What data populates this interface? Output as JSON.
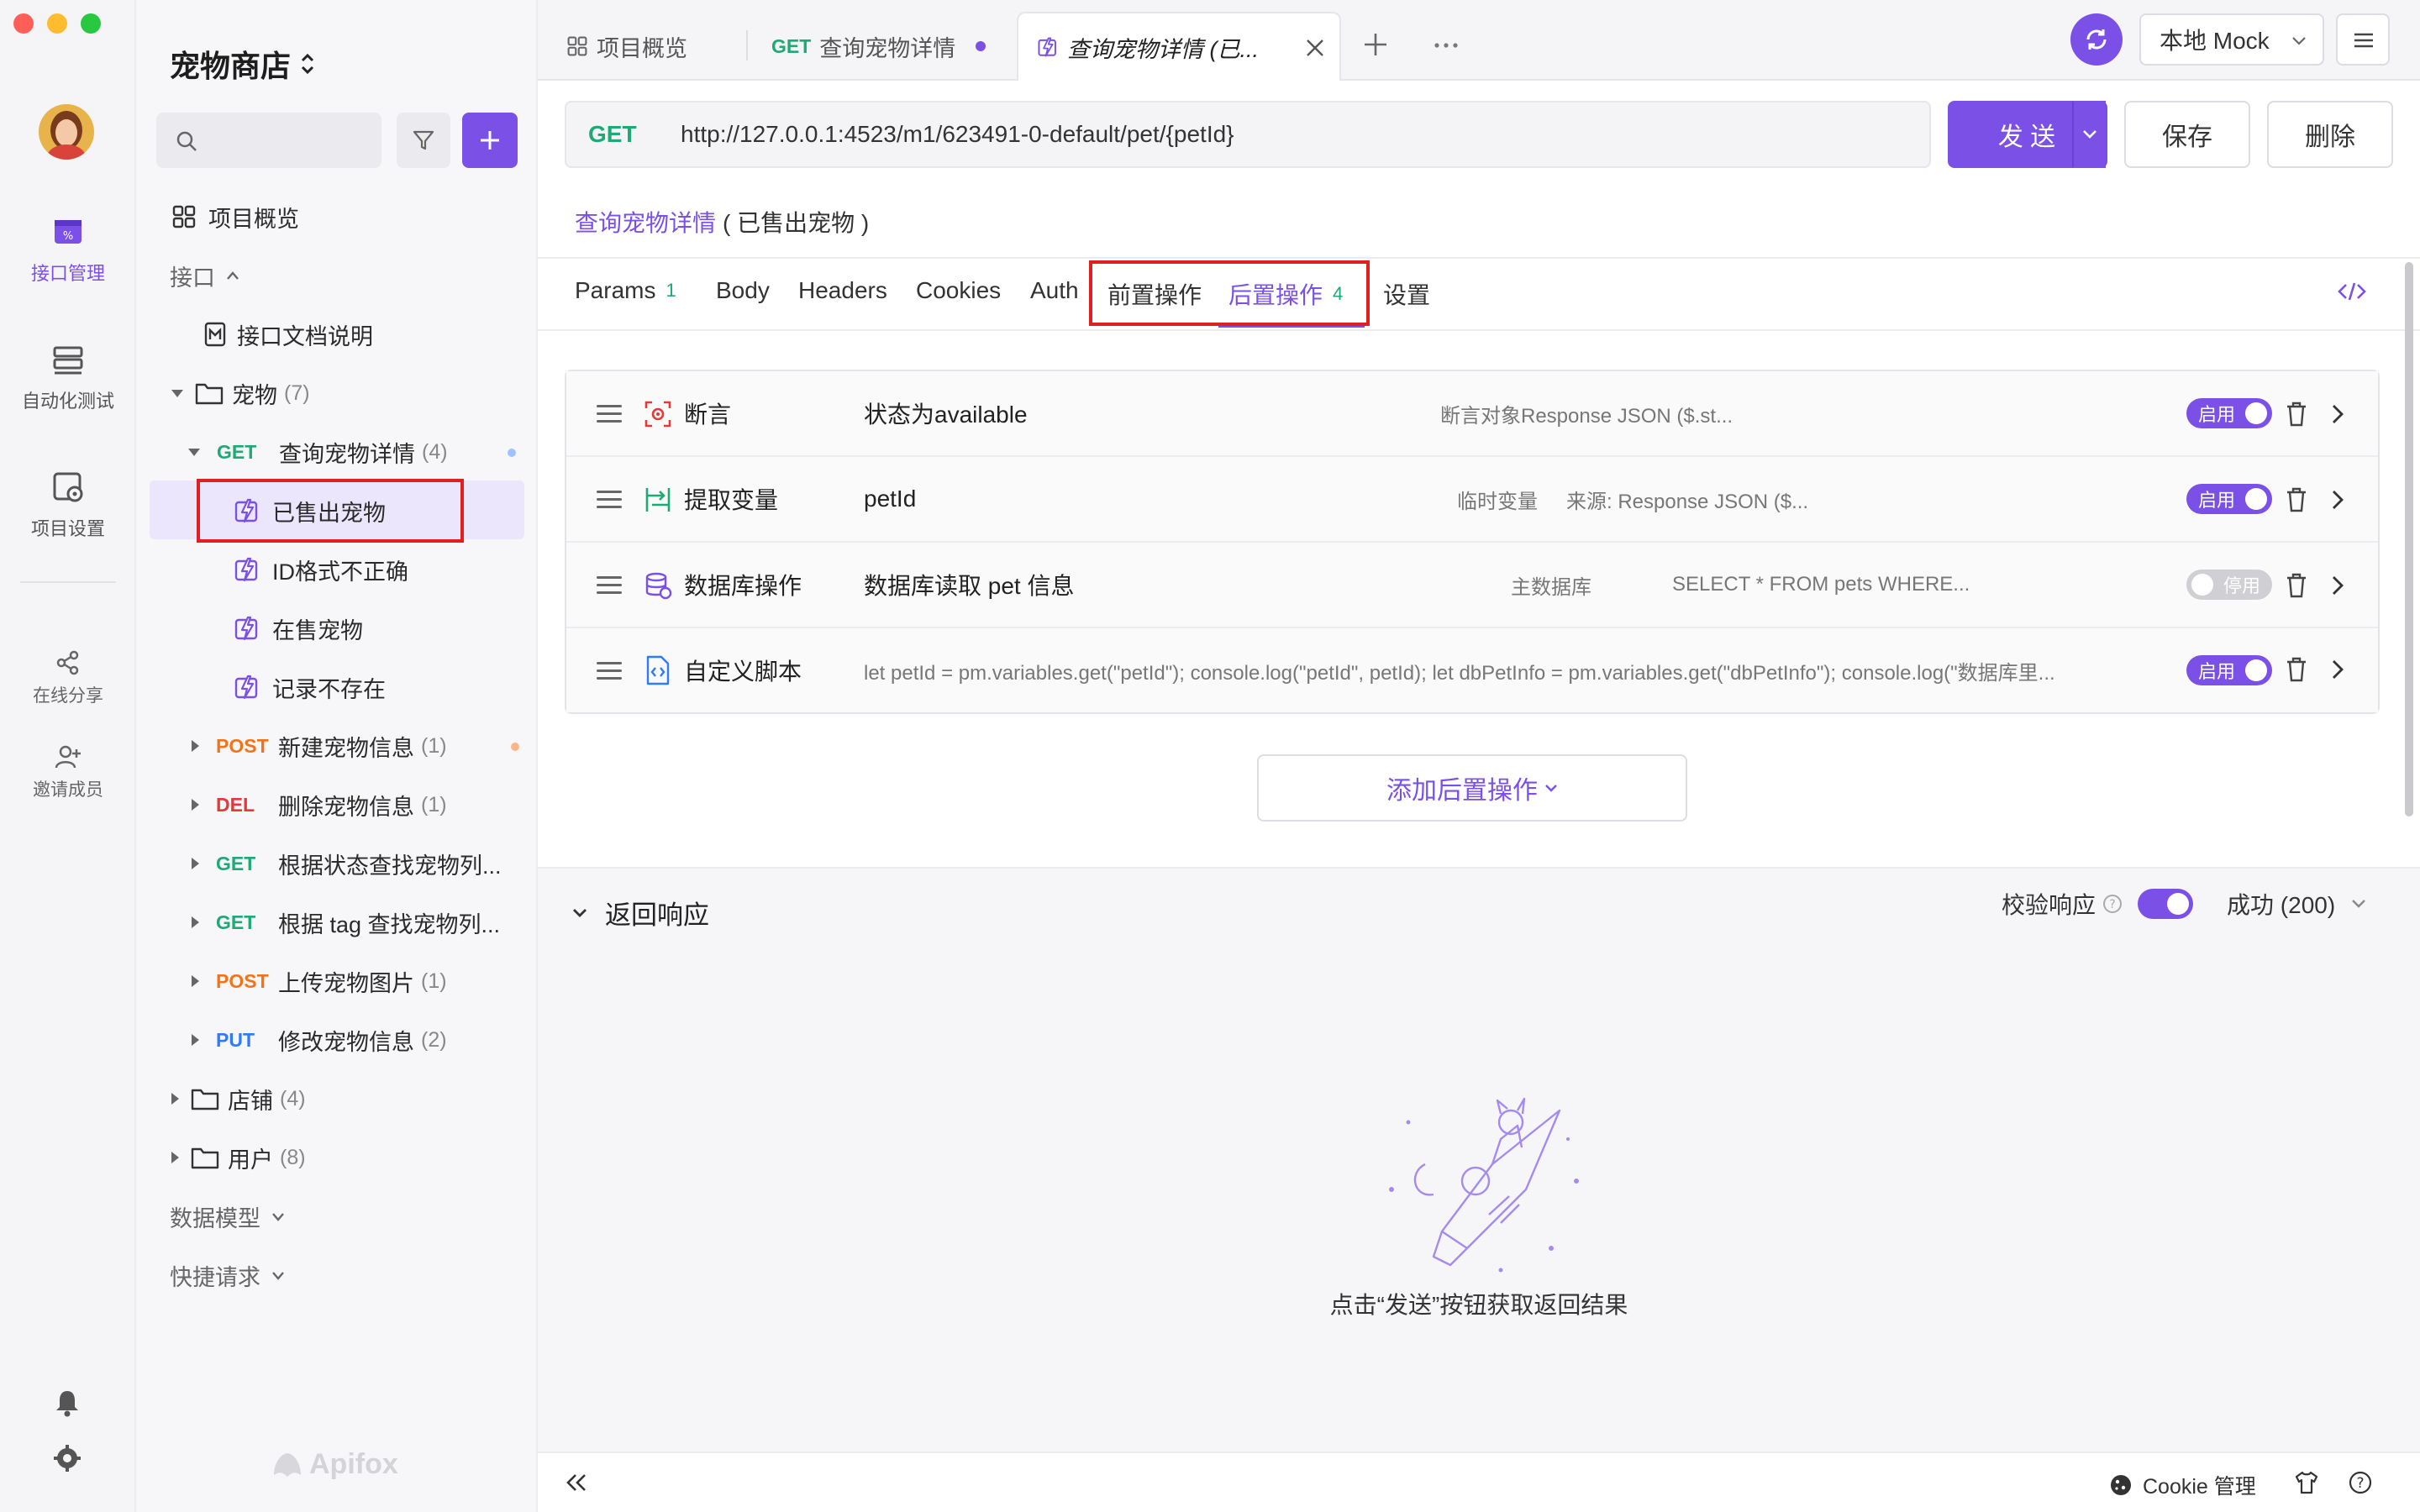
{
  "project": {
    "name": "宠物商店"
  },
  "rail": {
    "items": [
      {
        "label": "接口管理"
      },
      {
        "label": "自动化测试"
      },
      {
        "label": "项目设置"
      },
      {
        "label": "在线分享"
      },
      {
        "label": "邀请成员"
      }
    ]
  },
  "sidebar": {
    "overview": "项目概览",
    "api_group": "接口",
    "doc": "接口文档说明",
    "pet_folder": {
      "label": "宠物",
      "count": "(7)"
    },
    "endpoints": [
      {
        "method": "GET",
        "label": "查询宠物详情",
        "count": "(4)"
      },
      {
        "method": "POST",
        "label": "新建宠物信息",
        "count": "(1)"
      },
      {
        "method": "DEL",
        "label": "删除宠物信息",
        "count": "(1)"
      },
      {
        "method": "GET",
        "label": "根据状态查找宠物列...",
        "count": ""
      },
      {
        "method": "GET",
        "label": "根据 tag 查找宠物列...",
        "count": ""
      },
      {
        "method": "POST",
        "label": "上传宠物图片",
        "count": "(1)"
      },
      {
        "method": "PUT",
        "label": "修改宠物信息",
        "count": "(2)"
      }
    ],
    "cases": [
      "已售出宠物",
      "ID格式不正确",
      "在售宠物",
      "记录不存在"
    ],
    "shop_folder": {
      "label": "店铺",
      "count": "(4)"
    },
    "user_folder": {
      "label": "用户",
      "count": "(8)"
    },
    "data_model": "数据模型",
    "quick_request": "快捷请求",
    "brand": "Apifox"
  },
  "tabs": {
    "overview": "项目概览",
    "tab2_method": "GET",
    "tab2_label": "查询宠物详情",
    "tab3_label": "查询宠物详情 (已...",
    "env": "本地 Mock"
  },
  "request": {
    "method": "GET",
    "url": "http://127.0.0.1:4523/m1/623491-0-default/pet/{petId}",
    "send": "发 送",
    "save": "保存",
    "delete": "删除",
    "breadcrumb_link": "查询宠物详情",
    "breadcrumb_case": "( 已售出宠物 )"
  },
  "subtabs": {
    "params": "Params",
    "params_count": "1",
    "body": "Body",
    "headers": "Headers",
    "cookies": "Cookies",
    "auth": "Auth",
    "pre": "前置操作",
    "post": "后置操作",
    "post_count": "4",
    "settings": "设置"
  },
  "operations": [
    {
      "type": "断言",
      "main": "状态为available",
      "meta1": "断言对象Response JSON ($.st...",
      "meta2": "",
      "toggle": "启用",
      "enabled": true
    },
    {
      "type": "提取变量",
      "main": "petId",
      "meta1": "临时变量",
      "meta2": "来源: Response JSON ($...",
      "toggle": "启用",
      "enabled": true
    },
    {
      "type": "数据库操作",
      "main": "数据库读取 pet 信息",
      "meta1": "主数据库",
      "meta2": "SELECT * FROM pets WHERE...",
      "toggle": "停用",
      "enabled": false
    },
    {
      "type": "自定义脚本",
      "main": "",
      "meta1": "let petId = pm.variables.get(\"petId\"); console.log(\"petId\", petId); let dbPetInfo = pm.variables.get(\"dbPetInfo\"); console.log(\"数据库里...",
      "meta2": "",
      "toggle": "启用",
      "enabled": true
    }
  ],
  "add_post_op": "添加后置操作",
  "response": {
    "title": "返回响应",
    "validate": "校验响应",
    "status": "成功 (200)",
    "empty_hint": "点击“发送”按钮获取返回结果"
  },
  "footer": {
    "cookie": "Cookie 管理"
  },
  "colors": {
    "accent": "#7b50e6",
    "get": "#1fa974",
    "post": "#f2741a",
    "del": "#e53935",
    "put": "#2f7cf6",
    "highlight": "#e02020"
  }
}
